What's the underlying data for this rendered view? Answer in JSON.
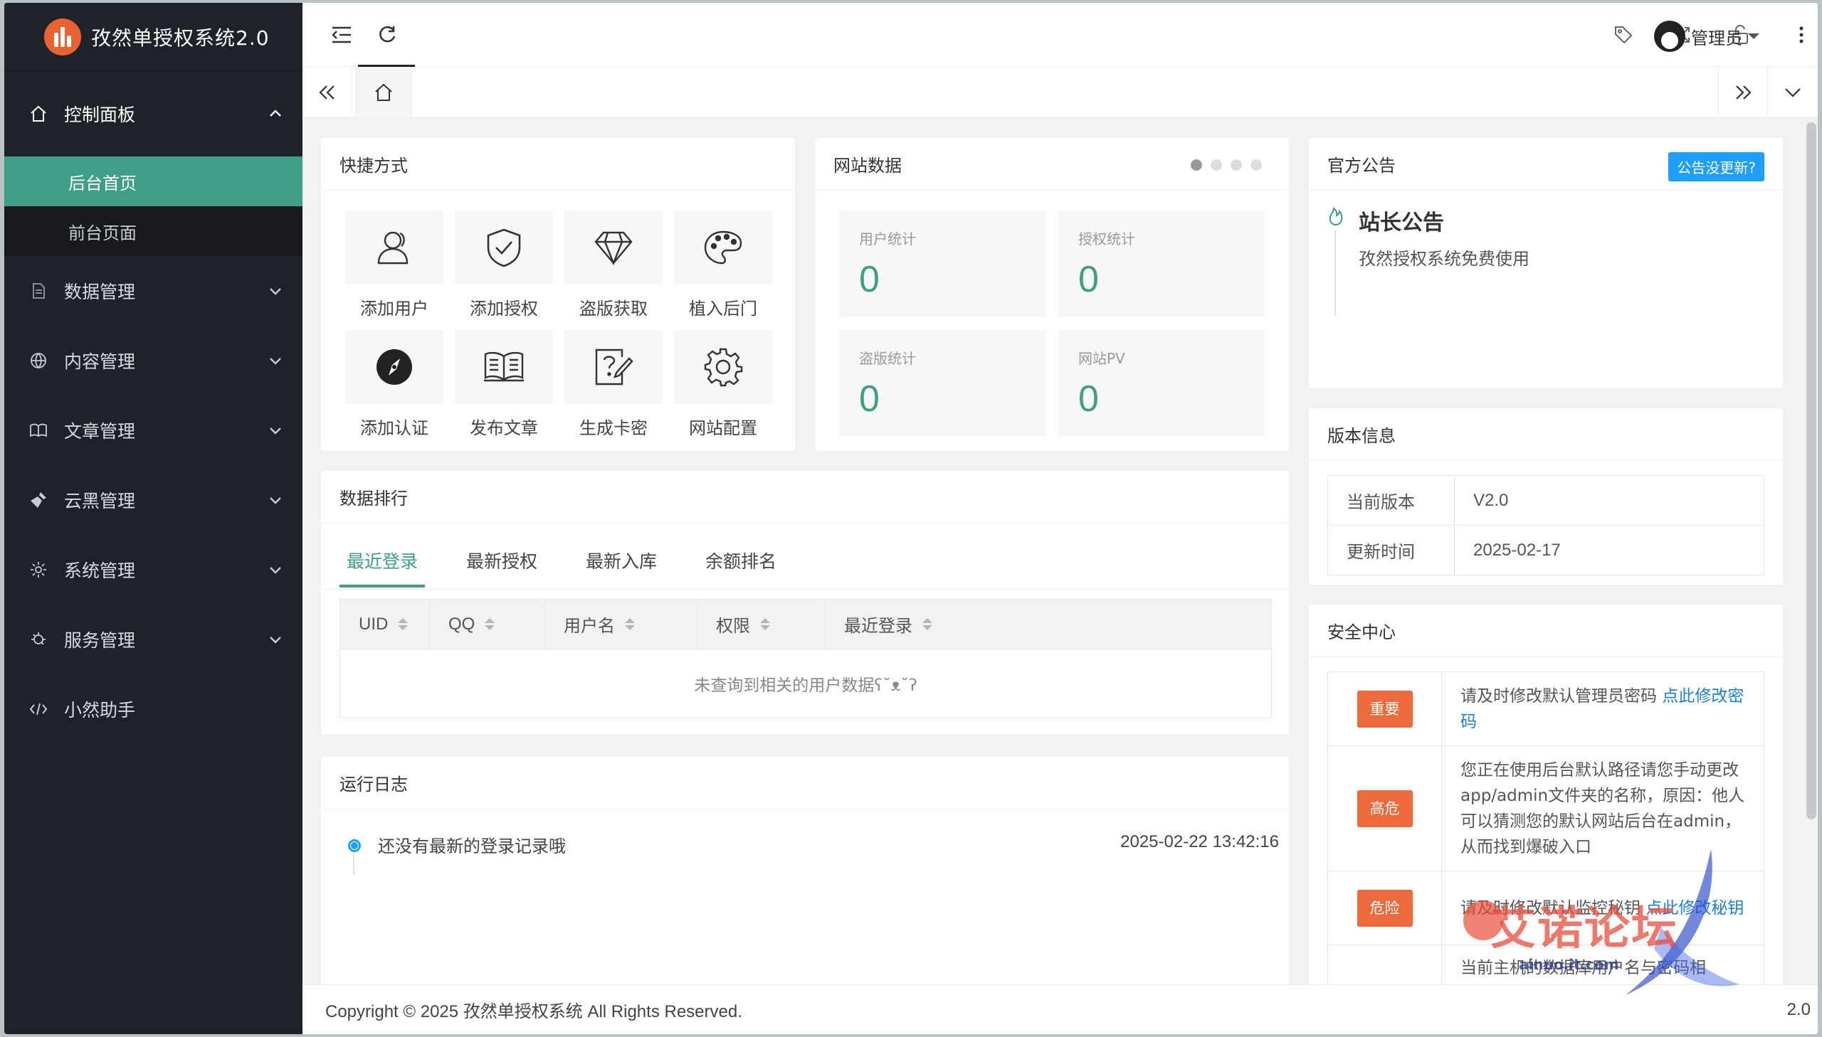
{
  "app": {
    "title": "孜然单授权系统2.0"
  },
  "sidebar": {
    "groups": [
      {
        "label": "控制面板",
        "icon": "home-icon",
        "children": [
          "后台首页",
          "前台页面"
        ]
      },
      {
        "label": "数据管理",
        "icon": "file-icon"
      },
      {
        "label": "内容管理",
        "icon": "globe-icon"
      },
      {
        "label": "文章管理",
        "icon": "book-icon"
      },
      {
        "label": "云黑管理",
        "icon": "broom-icon"
      },
      {
        "label": "系统管理",
        "icon": "gear-icon"
      },
      {
        "label": "服务管理",
        "icon": "service-icon"
      },
      {
        "label": "小然助手",
        "icon": "code-icon"
      }
    ]
  },
  "topbar": {
    "user": "管理员"
  },
  "quick": {
    "title": "快捷方式",
    "items": [
      {
        "label": "添加用户",
        "icon": "user-icon"
      },
      {
        "label": "添加授权",
        "icon": "shield-check-icon"
      },
      {
        "label": "盗版获取",
        "icon": "diamond-icon"
      },
      {
        "label": "植入后门",
        "icon": "palette-icon"
      },
      {
        "label": "添加认证",
        "icon": "compass-icon"
      },
      {
        "label": "发布文章",
        "icon": "book-open-icon"
      },
      {
        "label": "生成卡密",
        "icon": "doc-question-icon"
      },
      {
        "label": "网站配置",
        "icon": "gear-icon"
      }
    ]
  },
  "stats": {
    "title": "网站数据",
    "items": [
      {
        "label": "用户统计",
        "value": "0"
      },
      {
        "label": "授权统计",
        "value": "0"
      },
      {
        "label": "盗版统计",
        "value": "0"
      },
      {
        "label": "网站PV",
        "value": "0"
      }
    ]
  },
  "notice": {
    "title": "官方公告",
    "button": "公告没更新?",
    "heading": "站长公告",
    "text": "孜然授权系统免费使用"
  },
  "version": {
    "title": "版本信息",
    "rows": [
      [
        "当前版本",
        "V2.0"
      ],
      [
        "更新时间",
        "2025-02-17"
      ]
    ]
  },
  "ranking": {
    "title": "数据排行",
    "tabs": [
      "最近登录",
      "最新授权",
      "最新入库",
      "余额排名"
    ],
    "columns": [
      "UID",
      "QQ",
      "用户名",
      "权限",
      "最近登录"
    ],
    "empty": "未查询到相关的用户数据ʕ˘ᴥ˘ʔ"
  },
  "log": {
    "title": "运行日志",
    "text": "还没有最新的登录记录哦",
    "time": "2025-02-22 13:42:16"
  },
  "security": {
    "title": "安全中心",
    "rows": [
      {
        "level": "重要",
        "text": "请及时修改默认管理员密码",
        "link": "点此修改密码"
      },
      {
        "level": "高危",
        "text": "您正在使用后台默认路径请您手动更改app/admin文件夹的名称，原因：他人可以猜测您的默认网站后台在admin，从而找到爆破入口",
        "link": ""
      },
      {
        "level": "危险",
        "text": "请及时修改默认监控秘钥",
        "link": "点此修改秘钥"
      },
      {
        "level": "",
        "text": "当前主机的数据库用户名与密码相",
        "link": ""
      }
    ]
  },
  "footer": {
    "copyright": "Copyright © 2025 孜然单授权系统 All Rights Reserved.",
    "version": "2.0"
  },
  "watermark": {
    "text": "艾诺论坛",
    "sub": "ainuo.it.com"
  },
  "colors": {
    "sidebar": "#20222a",
    "accent": "#3f9e86",
    "blue": "#1e9fff",
    "danger": "#ed6a3a"
  }
}
